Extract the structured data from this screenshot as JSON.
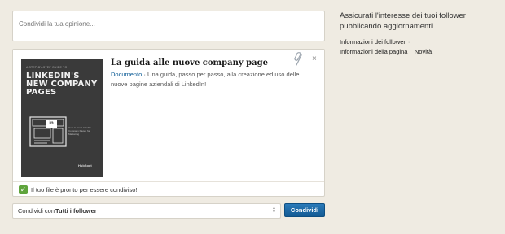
{
  "composer": {
    "placeholder": "Condividi la tua opinione..."
  },
  "attachment": {
    "thumbnail": {
      "top_text": "A STEP-BY-STEP GUIDE TO",
      "title": "LINKEDIN'S NEW COMPANY PAGES",
      "small_text": "How to Use LinkedIn Company Pages for Marketing",
      "logo": "HubSpot",
      "icon_label": "in"
    },
    "title": "La guida alle nuove company page",
    "type": "Documento",
    "separator": " · ",
    "description": "Una guida, passo per passo, alla creazione ed uso delle nuove pagine aziendali di LinkedIn!",
    "clip_icon": "paperclip-icon",
    "close_icon": "close-icon",
    "close_glyph": "×",
    "ready_text": "Il tuo file è pronto per essere condiviso!",
    "check_glyph": "✓"
  },
  "share": {
    "label": "Condividi con",
    "value": "Tutti i follower",
    "button": "Condividi",
    "arrows_up": "▲",
    "arrows_down": "▼"
  },
  "sidebar": {
    "title": "Assicurati l'interesse dei tuoi follower pubblicando aggiornamenti.",
    "links": [
      "Informazioni dei follower",
      "Informazioni della pagina",
      "Novità"
    ],
    "separator": "·"
  },
  "colors": {
    "accent": "#135b94",
    "check": "#5fa43c",
    "background": "#efebe2"
  }
}
